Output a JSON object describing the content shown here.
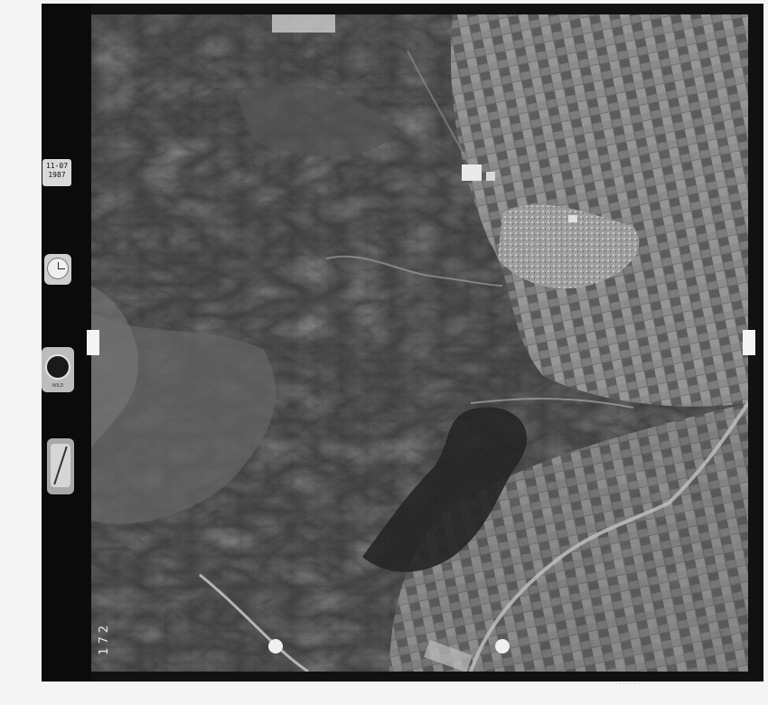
{
  "image": {
    "kind": "aerial-photograph",
    "frame_number": "172",
    "date_day_month": "11-07",
    "date_year": "1987",
    "instrument_labels": {
      "level_label": "WILD"
    },
    "edge_code": "......."
  },
  "colors": {
    "film_border": "#111111",
    "paper": "#f4f4f4",
    "terrain_dark": "#2c2c2c",
    "terrain_mid": "#5a5a5a",
    "fields_light": "#8a8a8a",
    "river": "#c9c9c9"
  }
}
